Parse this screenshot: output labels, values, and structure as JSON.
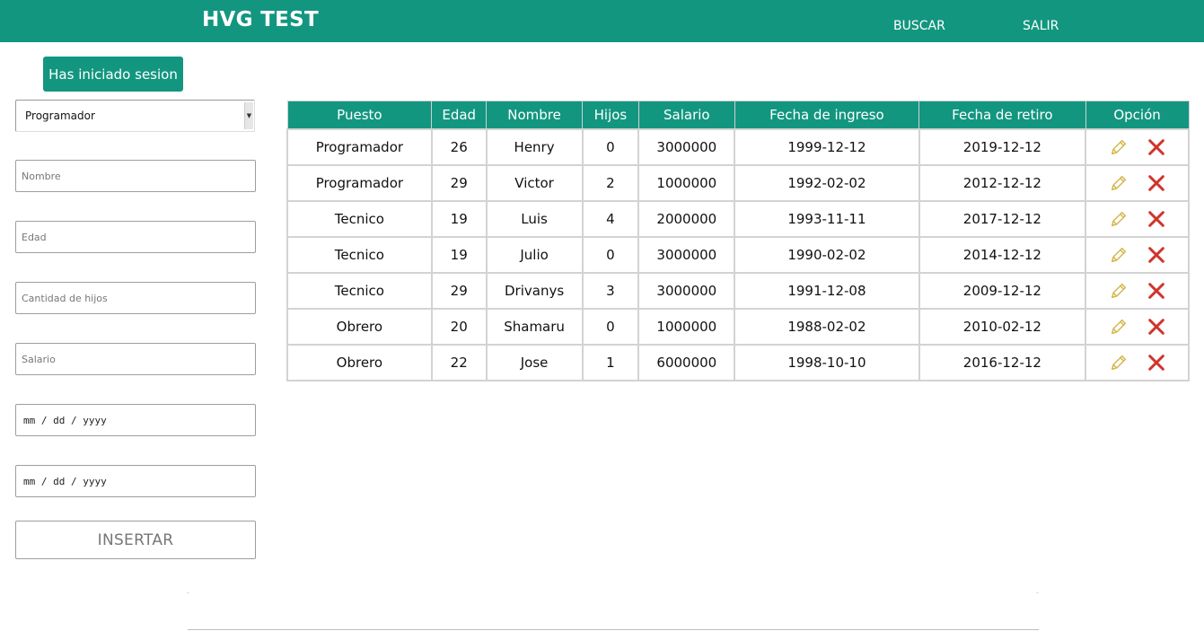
{
  "navbar": {
    "brand": "HVG TEST",
    "links": [
      "BUSCAR",
      "SALIR"
    ]
  },
  "session_badge": "Has iniciado sesion",
  "form": {
    "puesto_selected": "Programador",
    "nombre_placeholder": "Nombre",
    "edad_placeholder": "Edad",
    "hijos_placeholder": "Cantidad de hijos",
    "salario_placeholder": "Salario",
    "fecha_ingreso_placeholder": "mm / dd / yyyy",
    "fecha_retiro_placeholder": "mm / dd / yyyy",
    "insert_label": "INSERTAR"
  },
  "table": {
    "columns": [
      "Puesto",
      "Edad",
      "Nombre",
      "Hijos",
      "Salario",
      "Fecha de ingreso",
      "Fecha de retiro",
      "Opción"
    ],
    "rows": [
      [
        "Programador",
        "26",
        "Henry",
        "0",
        "3000000",
        "1999-12-12",
        "2019-12-12"
      ],
      [
        "Programador",
        "29",
        "Victor",
        "2",
        "1000000",
        "1992-02-02",
        "2012-12-12"
      ],
      [
        "Tecnico",
        "19",
        "Luis",
        "4",
        "2000000",
        "1993-11-11",
        "2017-12-12"
      ],
      [
        "Tecnico",
        "19",
        "Julio",
        "0",
        "3000000",
        "1990-02-02",
        "2014-12-12"
      ],
      [
        "Tecnico",
        "29",
        "Drivanys",
        "3",
        "3000000",
        "1991-12-08",
        "2009-12-12"
      ],
      [
        "Obrero",
        "20",
        "Shamaru",
        "0",
        "1000000",
        "1988-02-02",
        "2010-02-12"
      ],
      [
        "Obrero",
        "22",
        "Jose",
        "1",
        "6000000",
        "1998-10-10",
        "2016-12-12"
      ]
    ],
    "row_actions": [
      "pencil-icon",
      "delete-x-icon"
    ]
  },
  "colors": {
    "primary": "#139680",
    "edit_icon": "#d4b64a",
    "delete_icon": "#d0342c"
  }
}
